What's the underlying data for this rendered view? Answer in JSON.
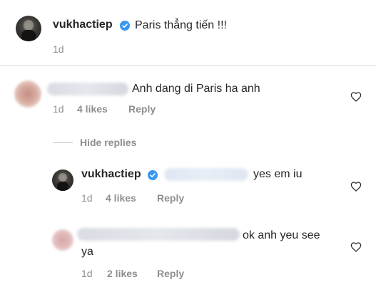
{
  "post": {
    "username": "vukhactiep",
    "caption": "Paris thẳng tiến !!!",
    "time": "1d"
  },
  "comments": [
    {
      "text": "Anh dang di Paris ha anh",
      "time": "1d",
      "likes": "4 likes",
      "reply_label": "Reply"
    }
  ],
  "hide_replies_label": "Hide replies",
  "replies": [
    {
      "username": "vukhactiep",
      "text": "yes em iu",
      "time": "1d",
      "likes": "4 likes",
      "reply_label": "Reply"
    },
    {
      "text_line1": "ok anh yeu see",
      "text_line2": "ya",
      "time": "1d",
      "likes": "2 likes",
      "reply_label": "Reply"
    }
  ],
  "icons": {
    "verified": "verified-badge-icon",
    "heart": "heart-outline-icon"
  },
  "colors": {
    "verified": "#3897f0",
    "text": "#262626",
    "meta": "#8e8e8e",
    "divider": "#dbdbdb"
  }
}
